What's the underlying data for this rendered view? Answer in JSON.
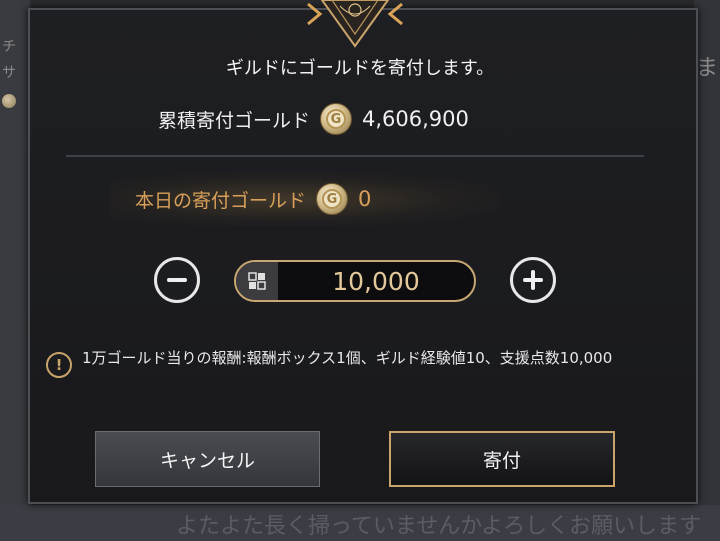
{
  "background": {
    "left_fragments": [
      "チ",
      "サ"
    ],
    "right_fragment": "ま",
    "bottom_chat": "よたよた長く掃っていませんかよろしくお願いします"
  },
  "dialog": {
    "title": "ギルドにゴールドを寄付します。",
    "total": {
      "label": "累積寄付ゴールド",
      "value": "4,606,900",
      "coin_icon": "gold-coin-icon"
    },
    "today": {
      "label": "本日の寄付ゴールド",
      "value": "0",
      "coin_icon": "gold-coin-icon"
    },
    "amount": {
      "value": "10,000",
      "keypad_icon": "keypad-icon"
    },
    "notice": {
      "icon": "warning-icon",
      "text": "1万ゴールド当りの報酬:報酬ボックス1個、ギルド経験値10、支援点数10,000"
    },
    "buttons": {
      "cancel": "キャンセル",
      "donate": "寄付"
    }
  },
  "colors": {
    "accent_gold": "#c8a872",
    "today_text": "#d8a05a",
    "dialog_bg": "#1c1d20"
  }
}
